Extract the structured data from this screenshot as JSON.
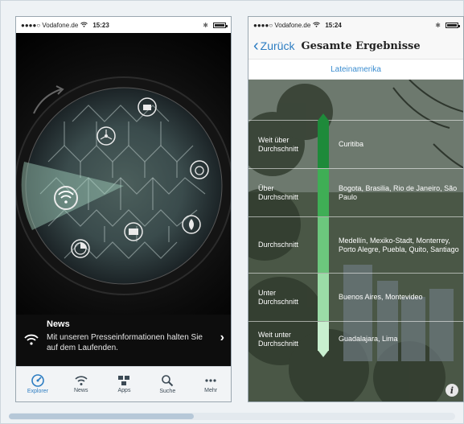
{
  "left_phone": {
    "status": {
      "carrier": "●●●●○ Vodafone.de",
      "time": "15:23"
    },
    "news": {
      "title": "News",
      "text": "Mit unseren Presseinformationen halten Sie auf dem Laufenden."
    },
    "tabs": [
      {
        "label": "Explorer",
        "icon": "explorer-icon",
        "active": true
      },
      {
        "label": "News",
        "icon": "wifi-icon",
        "active": false
      },
      {
        "label": "Apps",
        "icon": "apps-icon",
        "active": false
      },
      {
        "label": "Suche",
        "icon": "search-icon",
        "active": false
      },
      {
        "label": "Mehr",
        "icon": "more-icon",
        "active": false
      }
    ]
  },
  "right_phone": {
    "status": {
      "carrier": "●●●●○ Vodafone.de",
      "time": "15:24"
    },
    "nav": {
      "back_label": "Zurück",
      "title": "Gesamte Ergebnisse"
    },
    "region": "Lateinamerika",
    "rows": [
      {
        "label": "Weit über Durchschnitt",
        "cities": "Curitiba",
        "color": "#1e8a3a"
      },
      {
        "label": "Über Durchschnitt",
        "cities": "Bogota, Brasilia, Rio de Janeiro, São Paulo",
        "color": "#3fae55"
      },
      {
        "label": "Durchschnitt",
        "cities": "Medellín, Mexiko-Stadt, Monterrey, Porto Alegre, Puebla, Quito, Santiago",
        "color": "#6cc77d"
      },
      {
        "label": "Unter Durchschnitt",
        "cities": "Buenos Aires, Montevideo",
        "color": "#9bdca7"
      },
      {
        "label": "Weit unter Durchschnitt",
        "cities": "Guadalajara, Lima",
        "color": "#c8efcf"
      }
    ]
  },
  "colors": {
    "accent": "#2d7dc2",
    "region_text": "#3b8dd0"
  }
}
